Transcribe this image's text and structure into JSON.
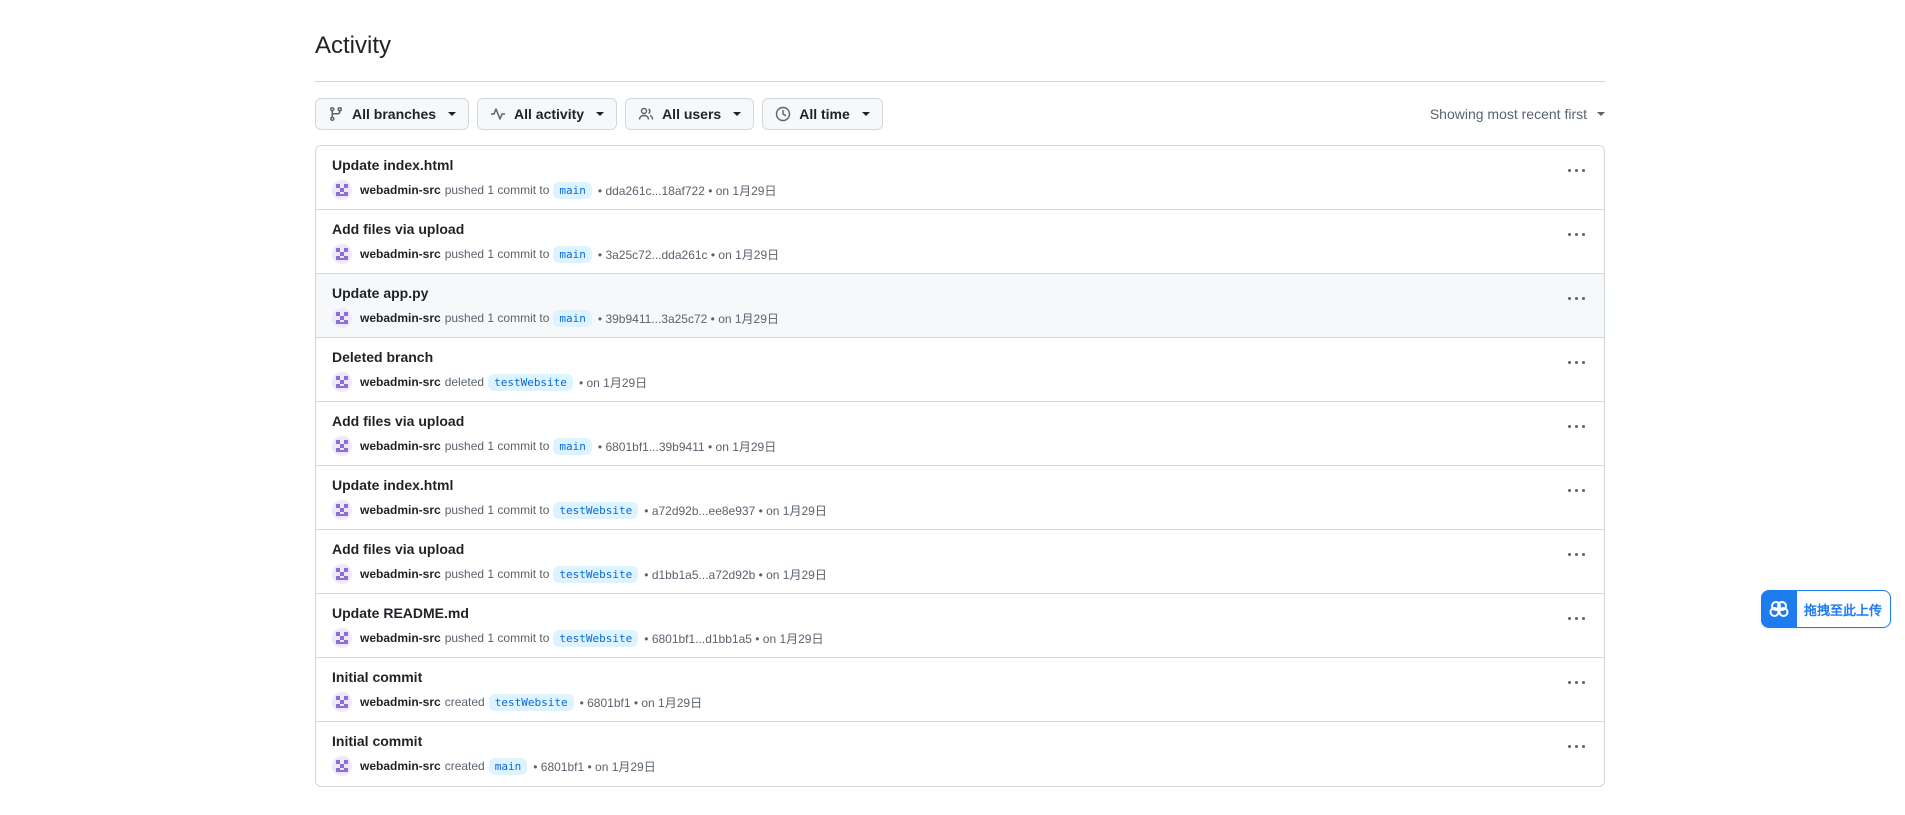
{
  "page": {
    "title": "Activity"
  },
  "filters": [
    {
      "icon": "git-branch-icon",
      "label": "All branches"
    },
    {
      "icon": "pulse-icon",
      "label": "All activity"
    },
    {
      "icon": "people-icon",
      "label": "All users"
    },
    {
      "icon": "clock-icon",
      "label": "All time"
    }
  ],
  "sort_label": "Showing most recent first",
  "activities": [
    {
      "title": "Update index.html",
      "user": "webadmin-src",
      "action": "pushed 1 commit to",
      "branch": "main",
      "detail": "• dda261c...18af722 • on 1月29日"
    },
    {
      "title": "Add files via upload",
      "user": "webadmin-src",
      "action": "pushed 1 commit to",
      "branch": "main",
      "detail": "• 3a25c72...dda261c • on 1月29日"
    },
    {
      "title": "Update app.py",
      "user": "webadmin-src",
      "action": "pushed 1 commit to",
      "branch": "main",
      "detail": "• 39b9411...3a25c72 • on 1月29日"
    },
    {
      "title": "Deleted branch",
      "user": "webadmin-src",
      "action": "deleted",
      "branch": "testWebsite",
      "detail": "• on 1月29日"
    },
    {
      "title": "Add files via upload",
      "user": "webadmin-src",
      "action": "pushed 1 commit to",
      "branch": "main",
      "detail": "• 6801bf1...39b9411 • on 1月29日"
    },
    {
      "title": "Update index.html",
      "user": "webadmin-src",
      "action": "pushed 1 commit to",
      "branch": "testWebsite",
      "detail": "• a72d92b...ee8e937 • on 1月29日"
    },
    {
      "title": "Add files via upload",
      "user": "webadmin-src",
      "action": "pushed 1 commit to",
      "branch": "testWebsite",
      "detail": "• d1bb1a5...a72d92b • on 1月29日"
    },
    {
      "title": "Update README.md",
      "user": "webadmin-src",
      "action": "pushed 1 commit to",
      "branch": "testWebsite",
      "detail": "• 6801bf1...d1bb1a5 • on 1月29日"
    },
    {
      "title": "Initial commit",
      "user": "webadmin-src",
      "action": "created",
      "branch": "testWebsite",
      "detail": "• 6801bf1 • on 1月29日"
    },
    {
      "title": "Initial commit",
      "user": "webadmin-src",
      "action": "created",
      "branch": "main",
      "detail": "• 6801bf1 • on 1月29日"
    }
  ],
  "upload_widget": {
    "icon": "cloud-upload-icon",
    "label": "拖拽至此上传"
  },
  "colors": {
    "accent": "#0969da",
    "branch_bg": "#ddf4ff",
    "upload_blue": "#1f7bf0",
    "hover_row": "#f6f8fa"
  }
}
